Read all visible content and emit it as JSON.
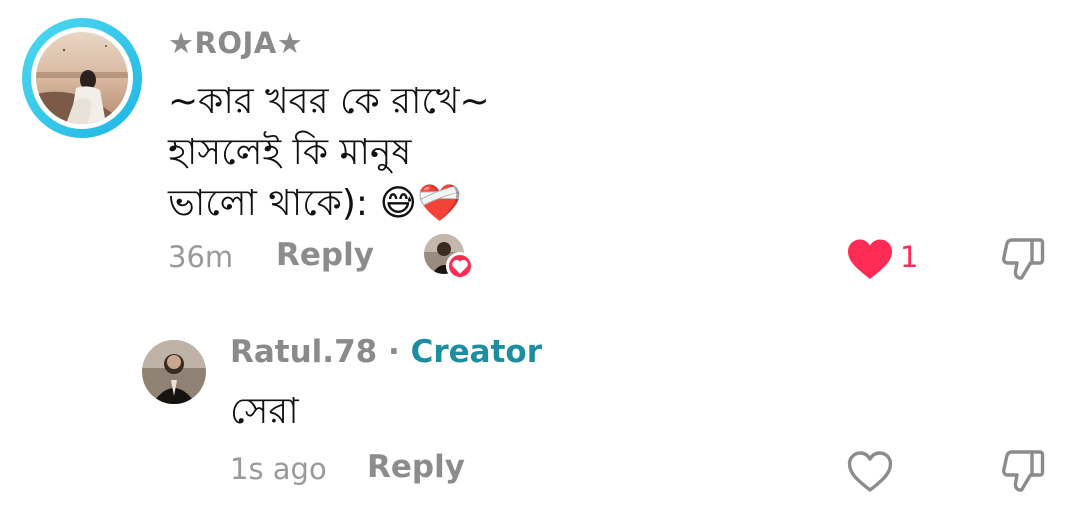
{
  "comment": {
    "username": "★ROJA★",
    "text_lines": [
      "~কার খবর কে রাখে~",
      "হাসলেই কি মানুষ",
      "ভালো থাকে): 😅❤️‍🩹"
    ],
    "time": "36m",
    "reply_label": "Reply",
    "like_count": "1",
    "liked": true,
    "liked_by_creator": true
  },
  "reply": {
    "username": "Ratul.78",
    "separator": "·",
    "creator_badge": "Creator",
    "text": "সেরা",
    "time": "1s ago",
    "reply_label": "Reply",
    "liked": false
  },
  "colors": {
    "like_red": "#fe2c55",
    "creator_teal": "#1c8e9f",
    "avatar_ring": "#1eb6e6",
    "muted_text": "#8a8a8a"
  },
  "icons": {
    "like": "heart-icon",
    "dislike": "thumbs-down-icon"
  }
}
